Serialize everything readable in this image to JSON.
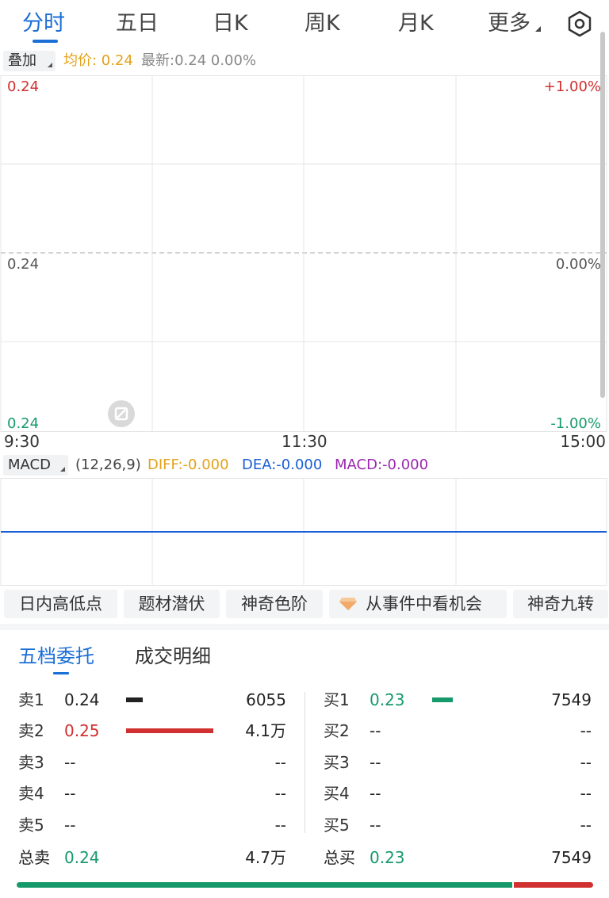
{
  "tabs": [
    {
      "label": "分时",
      "active": true
    },
    {
      "label": "五日",
      "active": false
    },
    {
      "label": "日K",
      "active": false
    },
    {
      "label": "周K",
      "active": false
    },
    {
      "label": "月K",
      "active": false
    },
    {
      "label": "更多",
      "active": false
    }
  ],
  "overlay": {
    "button_label": "叠加",
    "avg_price": "均价: 0.24",
    "latest": "最新:0.24 0.00%"
  },
  "chart": {
    "left_axis": {
      "top": "0.24",
      "mid": "0.24",
      "bottom": "0.24"
    },
    "right_axis": {
      "top": "+1.00%",
      "mid": "0.00%",
      "bottom": "-1.00%"
    },
    "times": {
      "start": "9:30",
      "mid": "11:30",
      "end": "15:00"
    },
    "colors": {
      "up": "#d0302f",
      "down": "#179a6b",
      "avg": "#e3a21a"
    }
  },
  "macd": {
    "button_label": "MACD",
    "params": "(12,26,9)",
    "diff": "DIFF:-0.000",
    "dea": "DEA:-0.000",
    "macd_value": "MACD:-0.000",
    "colors": {
      "diff": "#e3a21a",
      "dea": "#1a5fd6",
      "macd": "#9b27b0"
    }
  },
  "feature_tags": [
    "日内高低点",
    "题材潜伏",
    "神奇色阶",
    "从事件中看机会",
    "神奇九转"
  ],
  "order_book": {
    "tabs": [
      "五档委托",
      "成交明细"
    ],
    "sell": [
      {
        "label": "卖1",
        "price": "0.24",
        "volume": "6055"
      },
      {
        "label": "卖2",
        "price": "0.25",
        "volume": "4.1万"
      },
      {
        "label": "卖3",
        "price": "--",
        "volume": "--"
      },
      {
        "label": "卖4",
        "price": "--",
        "volume": "--"
      },
      {
        "label": "卖5",
        "price": "--",
        "volume": "--"
      }
    ],
    "buy": [
      {
        "label": "买1",
        "price": "0.23",
        "volume": "7549"
      },
      {
        "label": "买2",
        "price": "--",
        "volume": "--"
      },
      {
        "label": "买3",
        "price": "--",
        "volume": "--"
      },
      {
        "label": "买4",
        "price": "--",
        "volume": "--"
      },
      {
        "label": "买5",
        "price": "--",
        "volume": "--"
      }
    ],
    "total_sell": {
      "label": "总卖",
      "price": "0.24",
      "volume": "4.7万"
    },
    "total_buy": {
      "label": "总买",
      "price": "0.23",
      "volume": "7549"
    },
    "buy_share": 0.86
  }
}
